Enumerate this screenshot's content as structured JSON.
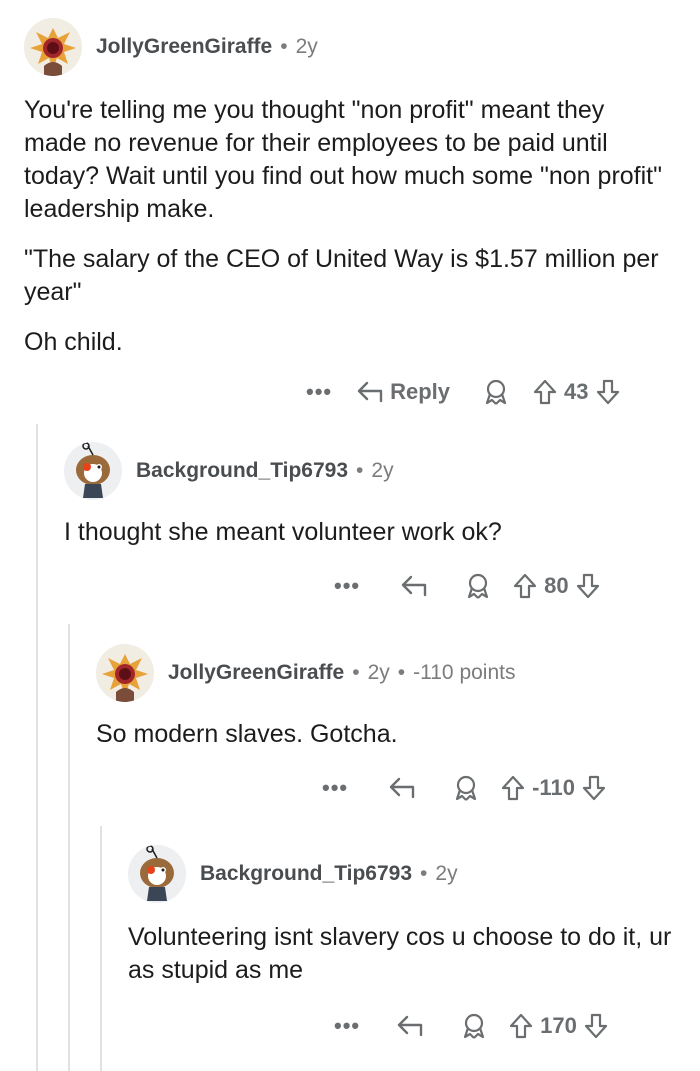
{
  "comments": [
    {
      "username": "JollyGreenGiraffe",
      "age": "2y",
      "points": "",
      "paragraphs": [
        "You're telling me you thought \"non profit\" meant they made no revenue for their employees to be paid until today? Wait until you find out how much some \"non profit\" leadership make.",
        "\"The salary of the CEO of United Way is $1.57 million per year\"",
        "Oh child."
      ],
      "reply_label": "Reply",
      "score": "43"
    },
    {
      "username": "Background_Tip6793",
      "age": "2y",
      "paragraphs": [
        "I thought she meant volunteer work ok?"
      ],
      "score": "80"
    },
    {
      "username": "JollyGreenGiraffe",
      "age": "2y",
      "points": "-110 points",
      "paragraphs": [
        "So modern slaves. Gotcha."
      ],
      "score": "-110"
    },
    {
      "username": "Background_Tip6793",
      "age": "2y",
      "paragraphs": [
        "Volunteering isnt slavery cos u choose to do it, ur as stupid as me"
      ],
      "score": "170"
    }
  ],
  "ui": {
    "separator": "•",
    "more": "•••"
  },
  "colors": {
    "text": "#1c1c1c",
    "meta": "#7c7c7c",
    "thread_line": "#dfe1e3"
  }
}
